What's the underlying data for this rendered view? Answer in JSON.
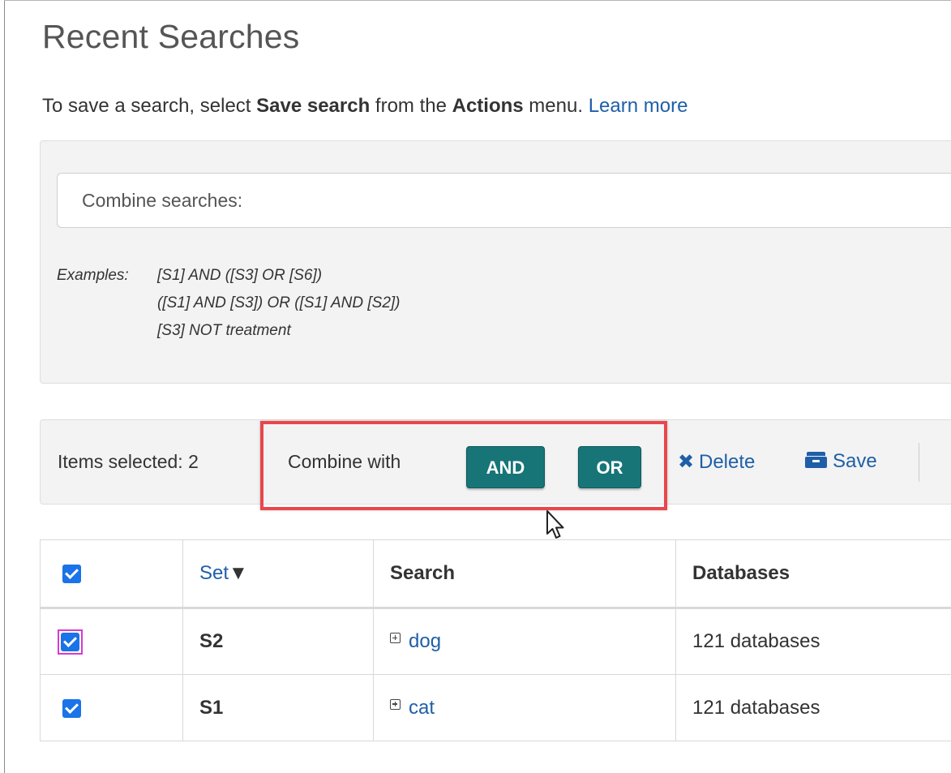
{
  "page": {
    "title": "Recent Searches",
    "intro": {
      "prefix": "To save a search, select ",
      "save_search": "Save search",
      "middle": " from the ",
      "actions": "Actions",
      "suffix": " menu. ",
      "learn_more": "Learn more"
    }
  },
  "combine": {
    "placeholder": "Combine searches:",
    "examples_label": "Examples:",
    "examples": [
      "[S1] AND ([S3] OR [S6])",
      "([S1] AND [S3]) OR ([S1] AND [S2])",
      "[S3] NOT treatment"
    ]
  },
  "actions_bar": {
    "items_selected": "Items selected: 2",
    "combine_with": "Combine with",
    "and_label": "AND",
    "or_label": "OR",
    "delete_label": "Delete",
    "save_label": "Save"
  },
  "table": {
    "headers": {
      "set": "Set",
      "sort_indicator": "▼",
      "search": "Search",
      "databases": "Databases"
    },
    "rows": [
      {
        "set": "S2",
        "search": "dog",
        "databases": "121 databases",
        "checked": true
      },
      {
        "set": "S1",
        "search": "cat",
        "databases": "121 databases",
        "checked": true
      }
    ]
  },
  "colors": {
    "accent_button": "#177578",
    "link": "#1f5fa8",
    "highlight": "#e8474b",
    "checkbox": "#1a73e8"
  },
  "icons": [
    "close-icon",
    "save-box-icon",
    "expand-plus-icon",
    "mouse-cursor-icon",
    "sort-down-icon",
    "checkbox-checked-icon"
  ]
}
